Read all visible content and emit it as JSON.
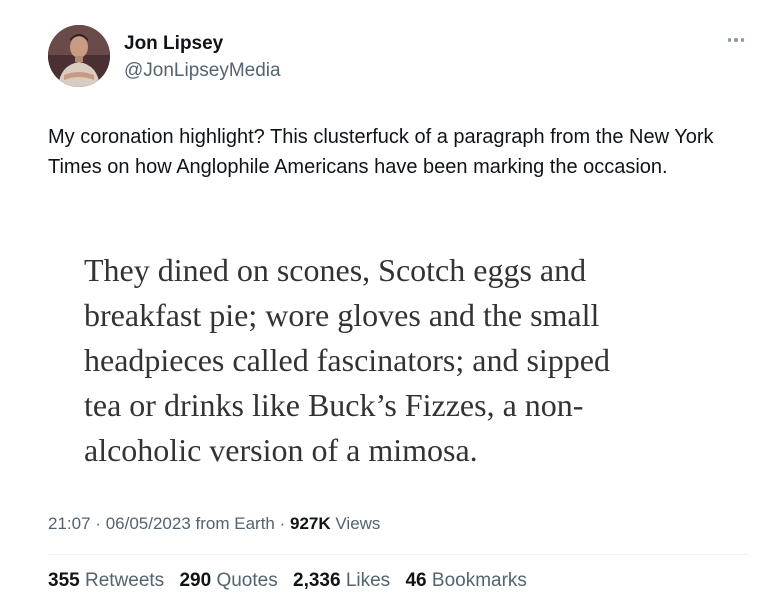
{
  "author": {
    "name": "Jon Lipsey",
    "handle": "@JonLipseyMedia",
    "avatar_icon": "profile-photo"
  },
  "more_icon": "more-dots-icon",
  "tweet_text": "My coronation highlight? This clusterfuck of a paragraph from the New York Times on how Anglophile Americans have been marking the occasion.",
  "quote_lines": [
    "They dined on scones, Scotch eggs and",
    "breakfast pie; wore gloves and the small",
    "headpieces called fascinators; and sipped",
    "tea or drinks like Buck’s Fizzes, a non-",
    "alcoholic version of a mimosa."
  ],
  "meta": {
    "time": "21:07",
    "separator": "·",
    "date": "06/05/2023",
    "source": "from Earth",
    "views_count": "927K",
    "views_label": "Views"
  },
  "stats": {
    "retweets_count": "355",
    "retweets_label": "Retweets",
    "quotes_count": "290",
    "quotes_label": "Quotes",
    "likes_count": "2,336",
    "likes_label": "Likes",
    "bookmarks_count": "46",
    "bookmarks_label": "Bookmarks"
  },
  "colors": {
    "text_primary": "#0f1419",
    "text_secondary": "#536471",
    "quote_text": "#333333",
    "divider": "#eff3f4",
    "background": "#ffffff"
  }
}
